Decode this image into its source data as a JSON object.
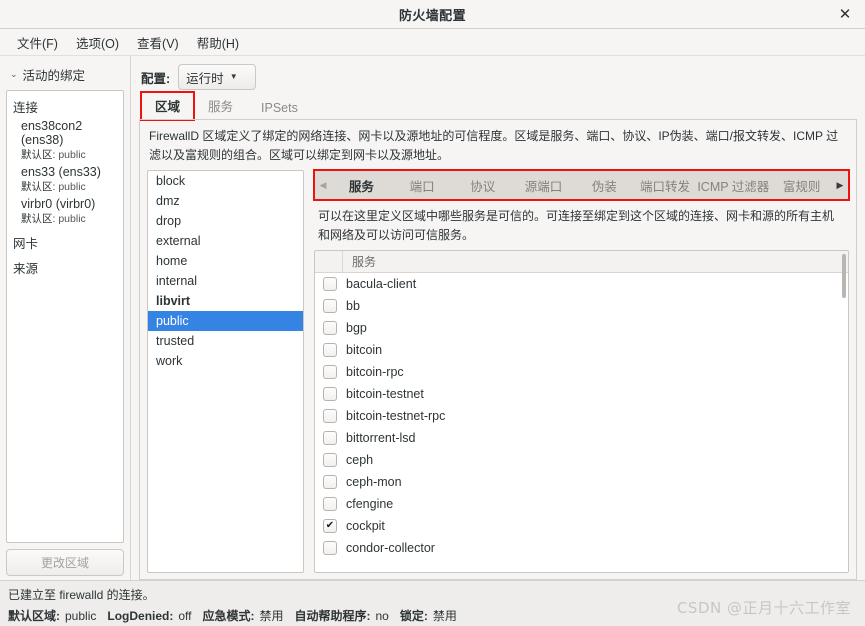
{
  "window": {
    "title": "防火墙配置",
    "close_label": "✕"
  },
  "menubar": {
    "items": [
      {
        "label": "文件(F)"
      },
      {
        "label": "选项(O)"
      },
      {
        "label": "查看(V)"
      },
      {
        "label": "帮助(H)"
      }
    ]
  },
  "sidebar": {
    "header": "活动的绑定",
    "chevron": "⌄",
    "groups": [
      {
        "label": "连接",
        "connections": [
          {
            "name": "ens38con2 (ens38)",
            "zone_label": "默认区:",
            "zone": "public"
          },
          {
            "name": "ens33 (ens33)",
            "zone_label": "默认区:",
            "zone": "public"
          },
          {
            "name": "virbr0 (virbr0)",
            "zone_label": "默认区:",
            "zone": "public"
          }
        ]
      },
      {
        "label": "网卡",
        "connections": []
      },
      {
        "label": "来源",
        "connections": []
      }
    ],
    "change_zone_button": "更改区域"
  },
  "config": {
    "label": "配置:",
    "selected": "运行时",
    "arrow": "▼"
  },
  "top_tabs": [
    {
      "label": "区域",
      "active": true,
      "highlight": true
    },
    {
      "label": "服务",
      "active": false,
      "highlight": false
    },
    {
      "label": "IPSets",
      "active": false,
      "highlight": false
    }
  ],
  "zone_description": "FirewallD 区域定义了绑定的网络连接、网卡以及源地址的可信程度。区域是服务、端口、协议、IP伪装、端口/报文转发、ICMP 过滤以及富规则的组合。区域可以绑定到网卡以及源地址。",
  "zones": [
    {
      "name": "block",
      "bold": false,
      "selected": false
    },
    {
      "name": "dmz",
      "bold": false,
      "selected": false
    },
    {
      "name": "drop",
      "bold": false,
      "selected": false
    },
    {
      "name": "external",
      "bold": false,
      "selected": false
    },
    {
      "name": "home",
      "bold": false,
      "selected": false
    },
    {
      "name": "internal",
      "bold": false,
      "selected": false
    },
    {
      "name": "libvirt",
      "bold": true,
      "selected": false
    },
    {
      "name": "public",
      "bold": false,
      "selected": true
    },
    {
      "name": "trusted",
      "bold": false,
      "selected": false
    },
    {
      "name": "work",
      "bold": false,
      "selected": false
    }
  ],
  "sub_tabs": {
    "scroll_left": "◀",
    "scroll_right": "▶",
    "highlight": true,
    "items": [
      {
        "label": "服务",
        "active": true
      },
      {
        "label": "端口",
        "active": false
      },
      {
        "label": "协议",
        "active": false
      },
      {
        "label": "源端口",
        "active": false
      },
      {
        "label": "伪装",
        "active": false
      },
      {
        "label": "端口转发",
        "active": false
      },
      {
        "label": "ICMP 过滤器",
        "active": false
      },
      {
        "label": "富规则",
        "active": false
      }
    ]
  },
  "services_panel": {
    "description": "可以在这里定义区域中哪些服务是可信的。可连接至绑定到这个区域的连接、网卡和源的所有主机和网络及可以访问可信服务。",
    "column_header": "服务",
    "rows": [
      {
        "name": "bacula-client",
        "checked": false
      },
      {
        "name": "bb",
        "checked": false
      },
      {
        "name": "bgp",
        "checked": false
      },
      {
        "name": "bitcoin",
        "checked": false
      },
      {
        "name": "bitcoin-rpc",
        "checked": false
      },
      {
        "name": "bitcoin-testnet",
        "checked": false
      },
      {
        "name": "bitcoin-testnet-rpc",
        "checked": false
      },
      {
        "name": "bittorrent-lsd",
        "checked": false
      },
      {
        "name": "ceph",
        "checked": false
      },
      {
        "name": "ceph-mon",
        "checked": false
      },
      {
        "name": "cfengine",
        "checked": false
      },
      {
        "name": "cockpit",
        "checked": true
      },
      {
        "name": "condor-collector",
        "checked": false
      }
    ],
    "check_glyph": "✔"
  },
  "statusbar": {
    "connection_message": "已建立至 firewalld 的连接。",
    "default_zone_label": "默认区域:",
    "default_zone_value": "public",
    "log_denied_label": "LogDenied:",
    "log_denied_value": "off",
    "panic_label": "应急模式:",
    "panic_value": "禁用",
    "autohelper_label": "自动帮助程序:",
    "autohelper_value": "no",
    "lockdown_label": "锁定:",
    "lockdown_value": "禁用"
  },
  "watermark": "CSDN @正月十六工作室",
  "colors": {
    "selection": "#3584e4",
    "highlight_box": "#ee1111",
    "window_bg": "#f6f5f4",
    "list_bg": "#ffffff"
  }
}
